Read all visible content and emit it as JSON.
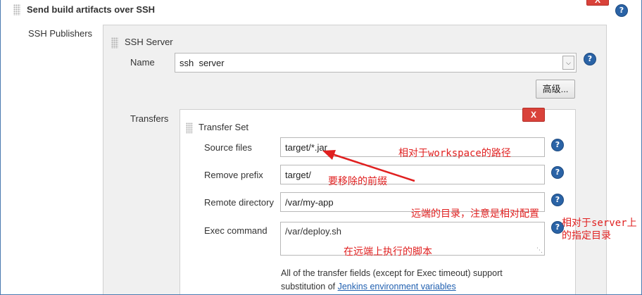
{
  "section": {
    "title": "Send build artifacts over SSH",
    "close_label": "X"
  },
  "publishers": {
    "label": "SSH Publishers",
    "server": {
      "heading": "SSH Server",
      "name_label": "Name",
      "name_value": "ssh  server",
      "advanced_label": "高级..."
    }
  },
  "transfers": {
    "label": "Transfers",
    "set_heading": "Transfer Set",
    "close_label": "X",
    "fields": {
      "source_files": {
        "label": "Source files",
        "value": "target/*.jar"
      },
      "remove_prefix": {
        "label": "Remove prefix",
        "value": "target/"
      },
      "remote_directory": {
        "label": "Remote directory",
        "value": "/var/my-app"
      },
      "exec_command": {
        "label": "Exec command",
        "value": "/var/deploy.sh"
      }
    },
    "note_prefix": "All of the transfer fields (except for Exec timeout) support substitution of ",
    "note_link": "Jenkins environment variables"
  },
  "annotations": {
    "source": "相对于workspace的路径",
    "prefix": "要移除的前缀",
    "remote": "远端的目录，注意是相对配置",
    "remote_side_1": "相对于server上",
    "remote_side_2": "的指定目录",
    "exec": "在远端上执行的脚本"
  },
  "help_icon_glyph": "?",
  "colors": {
    "annotation": "#e02020",
    "help": "#2a63a6",
    "close": "#d9423a",
    "link": "#1f5fb0"
  }
}
